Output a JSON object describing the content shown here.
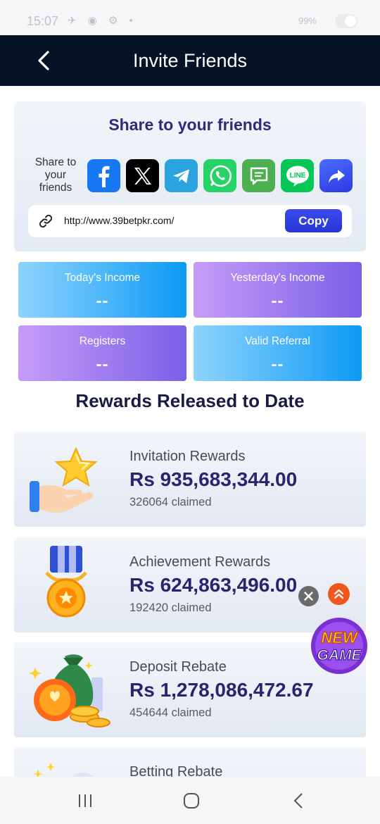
{
  "status_bar": {
    "time": "15:07",
    "icons": [
      "signal-icon",
      "wifi-icon",
      "settings-icon",
      "dot-icon"
    ],
    "right_text": "99%"
  },
  "header": {
    "title": "Invite Friends",
    "back_icon": "chevron-left-icon"
  },
  "share": {
    "title": "Share to your friends",
    "label": "Share to your friends",
    "platforms": [
      {
        "name": "facebook",
        "icon": "facebook-icon",
        "color": "#1877f2"
      },
      {
        "name": "x",
        "icon": "x-icon",
        "color": "#000000"
      },
      {
        "name": "telegram",
        "icon": "telegram-icon",
        "color": "#2aa3df"
      },
      {
        "name": "whatsapp",
        "icon": "whatsapp-icon",
        "color": "#25d366"
      },
      {
        "name": "sms",
        "icon": "message-icon",
        "color": "#4caf50"
      },
      {
        "name": "line",
        "icon": "line-icon",
        "color": "#06c755"
      },
      {
        "name": "more",
        "icon": "share-arrow-icon",
        "color": "#3a5af5"
      }
    ],
    "link": "http://www.39betpkr.com/",
    "copy_label": "Copy"
  },
  "stats": [
    {
      "label": "Today's Income",
      "value": "--",
      "style": "blue"
    },
    {
      "label": "Yesterday's Income",
      "value": "--",
      "style": "purple"
    },
    {
      "label": "Registers",
      "value": "--",
      "style": "purple"
    },
    {
      "label": "Valid Referral",
      "value": "--",
      "style": "blue"
    }
  ],
  "rewards_title": "Rewards Released to Date",
  "rewards": [
    {
      "name": "Invitation Rewards",
      "amount": "Rs  935,683,344.00",
      "claimed": "326064 claimed",
      "icon": "star-hand-icon"
    },
    {
      "name": "Achievement Rewards",
      "amount": "Rs  624,863,496.00",
      "claimed": "192420 claimed",
      "icon": "medal-icon"
    },
    {
      "name": "Deposit Rebate",
      "amount": "Rs  1,278,086,472.67",
      "claimed": "454644 claimed",
      "icon": "money-bag-icon"
    },
    {
      "name": "Betting Rebate",
      "amount": "",
      "claimed": "",
      "icon": "sparkle-icon"
    }
  ],
  "floating": {
    "close_icon": "close-icon",
    "scroll_top_icon": "double-chevron-up-icon",
    "new_game_text": [
      "NEW",
      "GAME"
    ]
  },
  "nav": {
    "recents_icon": "recents-icon",
    "home_icon": "home-icon",
    "back_icon": "back-icon"
  },
  "colors": {
    "header_bg": "#061326",
    "accent": "#2f2a7c",
    "copy_button": "#2f3fe6"
  }
}
